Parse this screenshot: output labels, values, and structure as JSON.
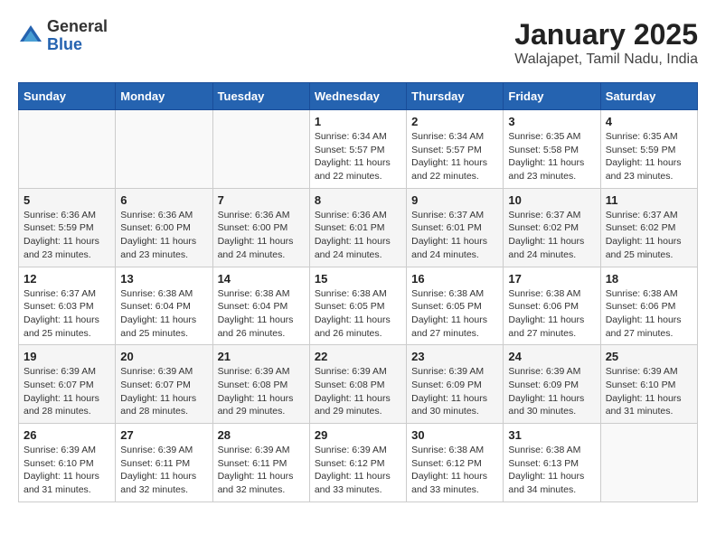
{
  "header": {
    "logo": {
      "general": "General",
      "blue": "Blue"
    },
    "title": "January 2025",
    "subtitle": "Walajapet, Tamil Nadu, India"
  },
  "weekdays": [
    "Sunday",
    "Monday",
    "Tuesday",
    "Wednesday",
    "Thursday",
    "Friday",
    "Saturday"
  ],
  "weeks": [
    [
      {
        "day": "",
        "info": ""
      },
      {
        "day": "",
        "info": ""
      },
      {
        "day": "",
        "info": ""
      },
      {
        "day": "1",
        "info": "Sunrise: 6:34 AM\nSunset: 5:57 PM\nDaylight: 11 hours\nand 22 minutes."
      },
      {
        "day": "2",
        "info": "Sunrise: 6:34 AM\nSunset: 5:57 PM\nDaylight: 11 hours\nand 22 minutes."
      },
      {
        "day": "3",
        "info": "Sunrise: 6:35 AM\nSunset: 5:58 PM\nDaylight: 11 hours\nand 23 minutes."
      },
      {
        "day": "4",
        "info": "Sunrise: 6:35 AM\nSunset: 5:59 PM\nDaylight: 11 hours\nand 23 minutes."
      }
    ],
    [
      {
        "day": "5",
        "info": "Sunrise: 6:36 AM\nSunset: 5:59 PM\nDaylight: 11 hours\nand 23 minutes."
      },
      {
        "day": "6",
        "info": "Sunrise: 6:36 AM\nSunset: 6:00 PM\nDaylight: 11 hours\nand 23 minutes."
      },
      {
        "day": "7",
        "info": "Sunrise: 6:36 AM\nSunset: 6:00 PM\nDaylight: 11 hours\nand 24 minutes."
      },
      {
        "day": "8",
        "info": "Sunrise: 6:36 AM\nSunset: 6:01 PM\nDaylight: 11 hours\nand 24 minutes."
      },
      {
        "day": "9",
        "info": "Sunrise: 6:37 AM\nSunset: 6:01 PM\nDaylight: 11 hours\nand 24 minutes."
      },
      {
        "day": "10",
        "info": "Sunrise: 6:37 AM\nSunset: 6:02 PM\nDaylight: 11 hours\nand 24 minutes."
      },
      {
        "day": "11",
        "info": "Sunrise: 6:37 AM\nSunset: 6:02 PM\nDaylight: 11 hours\nand 25 minutes."
      }
    ],
    [
      {
        "day": "12",
        "info": "Sunrise: 6:37 AM\nSunset: 6:03 PM\nDaylight: 11 hours\nand 25 minutes."
      },
      {
        "day": "13",
        "info": "Sunrise: 6:38 AM\nSunset: 6:04 PM\nDaylight: 11 hours\nand 25 minutes."
      },
      {
        "day": "14",
        "info": "Sunrise: 6:38 AM\nSunset: 6:04 PM\nDaylight: 11 hours\nand 26 minutes."
      },
      {
        "day": "15",
        "info": "Sunrise: 6:38 AM\nSunset: 6:05 PM\nDaylight: 11 hours\nand 26 minutes."
      },
      {
        "day": "16",
        "info": "Sunrise: 6:38 AM\nSunset: 6:05 PM\nDaylight: 11 hours\nand 27 minutes."
      },
      {
        "day": "17",
        "info": "Sunrise: 6:38 AM\nSunset: 6:06 PM\nDaylight: 11 hours\nand 27 minutes."
      },
      {
        "day": "18",
        "info": "Sunrise: 6:38 AM\nSunset: 6:06 PM\nDaylight: 11 hours\nand 27 minutes."
      }
    ],
    [
      {
        "day": "19",
        "info": "Sunrise: 6:39 AM\nSunset: 6:07 PM\nDaylight: 11 hours\nand 28 minutes."
      },
      {
        "day": "20",
        "info": "Sunrise: 6:39 AM\nSunset: 6:07 PM\nDaylight: 11 hours\nand 28 minutes."
      },
      {
        "day": "21",
        "info": "Sunrise: 6:39 AM\nSunset: 6:08 PM\nDaylight: 11 hours\nand 29 minutes."
      },
      {
        "day": "22",
        "info": "Sunrise: 6:39 AM\nSunset: 6:08 PM\nDaylight: 11 hours\nand 29 minutes."
      },
      {
        "day": "23",
        "info": "Sunrise: 6:39 AM\nSunset: 6:09 PM\nDaylight: 11 hours\nand 30 minutes."
      },
      {
        "day": "24",
        "info": "Sunrise: 6:39 AM\nSunset: 6:09 PM\nDaylight: 11 hours\nand 30 minutes."
      },
      {
        "day": "25",
        "info": "Sunrise: 6:39 AM\nSunset: 6:10 PM\nDaylight: 11 hours\nand 31 minutes."
      }
    ],
    [
      {
        "day": "26",
        "info": "Sunrise: 6:39 AM\nSunset: 6:10 PM\nDaylight: 11 hours\nand 31 minutes."
      },
      {
        "day": "27",
        "info": "Sunrise: 6:39 AM\nSunset: 6:11 PM\nDaylight: 11 hours\nand 32 minutes."
      },
      {
        "day": "28",
        "info": "Sunrise: 6:39 AM\nSunset: 6:11 PM\nDaylight: 11 hours\nand 32 minutes."
      },
      {
        "day": "29",
        "info": "Sunrise: 6:39 AM\nSunset: 6:12 PM\nDaylight: 11 hours\nand 33 minutes."
      },
      {
        "day": "30",
        "info": "Sunrise: 6:38 AM\nSunset: 6:12 PM\nDaylight: 11 hours\nand 33 minutes."
      },
      {
        "day": "31",
        "info": "Sunrise: 6:38 AM\nSunset: 6:13 PM\nDaylight: 11 hours\nand 34 minutes."
      },
      {
        "day": "",
        "info": ""
      }
    ]
  ]
}
